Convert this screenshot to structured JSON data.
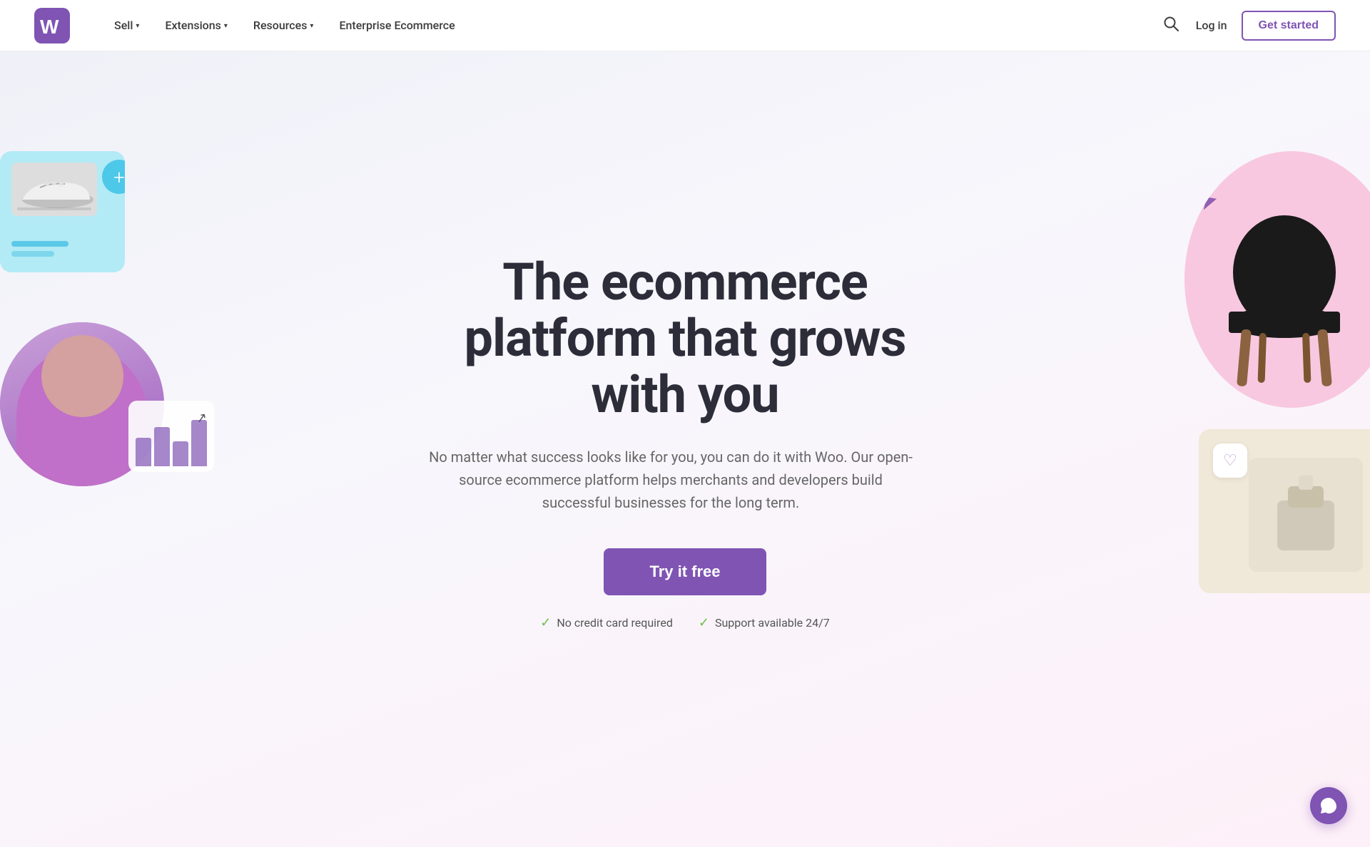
{
  "nav": {
    "logo_alt": "WooCommerce",
    "links": [
      {
        "label": "Sell",
        "has_dropdown": true
      },
      {
        "label": "Extensions",
        "has_dropdown": true
      },
      {
        "label": "Resources",
        "has_dropdown": true
      },
      {
        "label": "Enterprise Ecommerce",
        "has_dropdown": false
      }
    ],
    "search_label": "Search",
    "login_label": "Log in",
    "get_started_label": "Get started"
  },
  "hero": {
    "title": "The ecommerce platform that grows with you",
    "subtitle": "No matter what success looks like for you, you can do it with Woo. Our open-source ecommerce platform helps merchants and developers build successful businesses for the long term.",
    "cta_label": "Try it free",
    "badge1": "No credit card required",
    "badge2": "Support available 24/7"
  },
  "colors": {
    "brand_purple": "#7f54b3",
    "brand_teal": "#4dc8e8",
    "check_green": "#6cc04a"
  }
}
